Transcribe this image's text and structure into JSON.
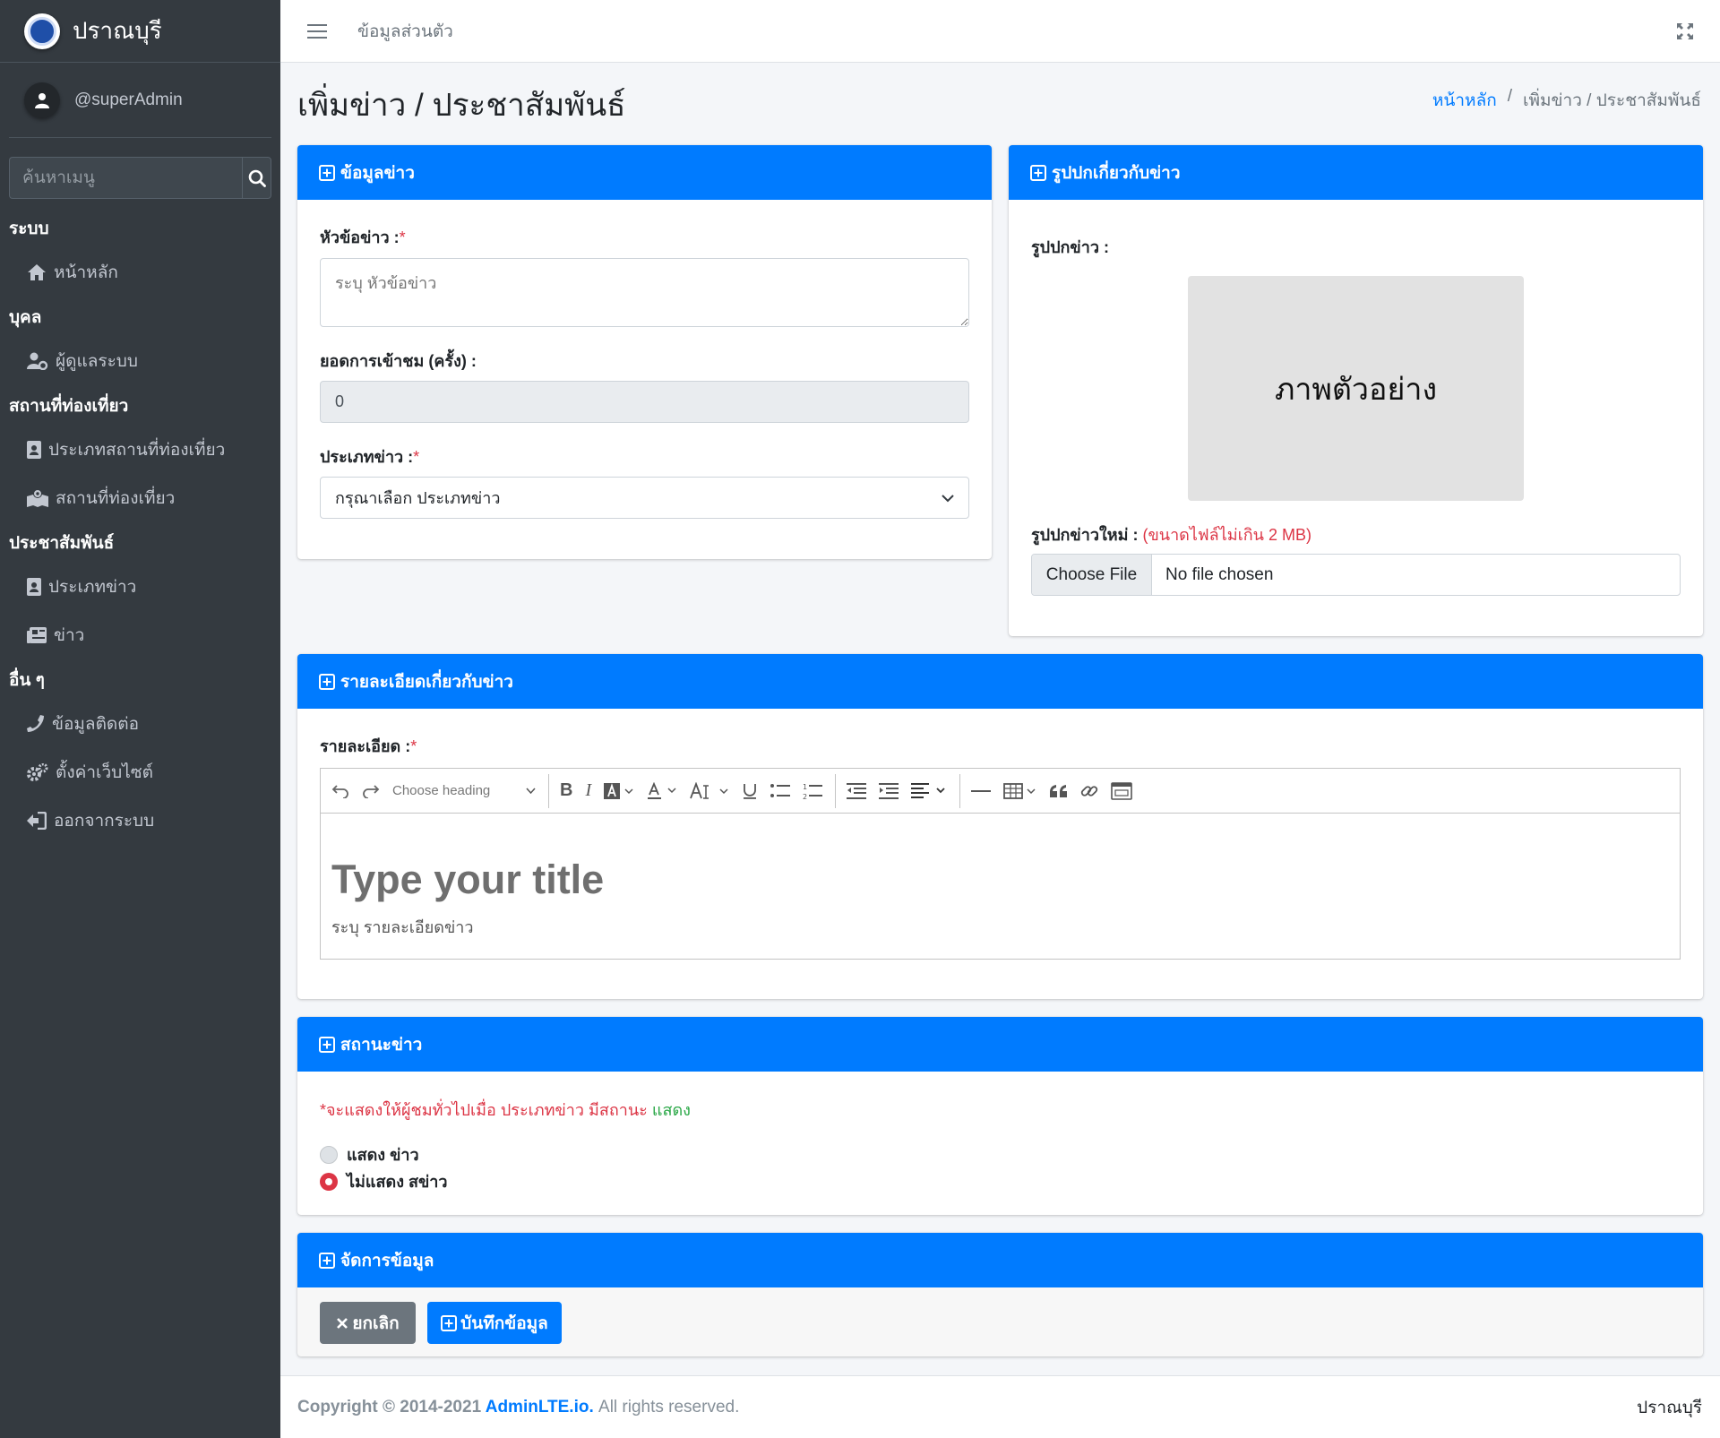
{
  "brand": {
    "name": "ปราณบุรี"
  },
  "user": {
    "name": "@superAdmin"
  },
  "sidebar_search": {
    "placeholder": "ค้นหาเมนู"
  },
  "nav": {
    "header_system": "ระบบ",
    "home": "หน้าหลัก",
    "header_people": "บุคล",
    "admins": "ผู้ดูแลระบบ",
    "header_places": "สถานที่ท่องเที่ยว",
    "place_types": "ประเภทสถานที่ท่องเที่ยว",
    "places": "สถานที่ท่องเที่ยว",
    "header_pr": "ประชาสัมพันธ์",
    "news_types": "ประเภทข่าว",
    "news": "ข่าว",
    "header_other": "อื่น ๆ",
    "contact": "ข้อมูลติดต่อ",
    "settings": "ตั้งค่าเว็บไซต์",
    "logout": "ออกจากระบบ"
  },
  "topbar": {
    "link": "ข้อมูลส่วนตัว"
  },
  "page": {
    "title": "เพิ่มข่าว / ประชาสัมพันธ์",
    "breadcrumb_home": "หน้าหลัก",
    "breadcrumb_sep": "/",
    "breadcrumb_current": "เพิ่มข่าว / ประชาสัมพันธ์"
  },
  "news_info": {
    "header": "ข้อมูลข่าว",
    "title_label": "หัวข้อข่าว :",
    "required_mark": "*",
    "title_placeholder": "ระบุ หัวข้อข่าว",
    "views_label": "ยอดการเข้าชม (ครั้ง) :",
    "views_value": "0",
    "type_label": "ประเภทข่าว :",
    "type_selected": "กรุณาเลือก ประเภทข่าว"
  },
  "cover": {
    "header": "รูปปกเกี่ยวกับข่าว",
    "label": "รูปปกข่าว :",
    "preview_text": "ภาพตัวอย่าง",
    "new_label": "รูปปกข่าวใหม่ :",
    "size_note": "(ขนาดไฟล์ไม่เกิน 2 MB)",
    "choose_button": "Choose File",
    "no_file": "No file chosen"
  },
  "details": {
    "header": "รายละเอียดเกี่ยวกับข่าว",
    "label": "รายละเอียด :",
    "heading_select": "Choose heading",
    "editor_title_placeholder": "Type your title",
    "editor_body_placeholder": "ระบุ รายละเอียดข่าว"
  },
  "status": {
    "header": "สถานะข่าว",
    "note_prefix": "*จะแสดงให้ผู้ชมทั่วไปเมื่อ ประเภทข่าว มีสถานะ",
    "note_show": "แสดง",
    "option_show": "แสดง ข่าว",
    "option_hide": "ไม่แสดง สข่าว",
    "selected": "option_hide"
  },
  "manage": {
    "header": "จัดการข้อมูล",
    "cancel": "ยกเลิก",
    "save": "บันทึกข้อมูล"
  },
  "footer": {
    "copyright_prefix": "Copyright © 2014-2021",
    "link": "AdminLTE.io.",
    "suffix": "All rights reserved.",
    "right": "ปราณบุรี"
  },
  "colors": {
    "primary": "#007bff",
    "sidebar": "#343a40",
    "danger": "#dc3545",
    "success": "#28a745",
    "secondary": "#6c757d"
  }
}
